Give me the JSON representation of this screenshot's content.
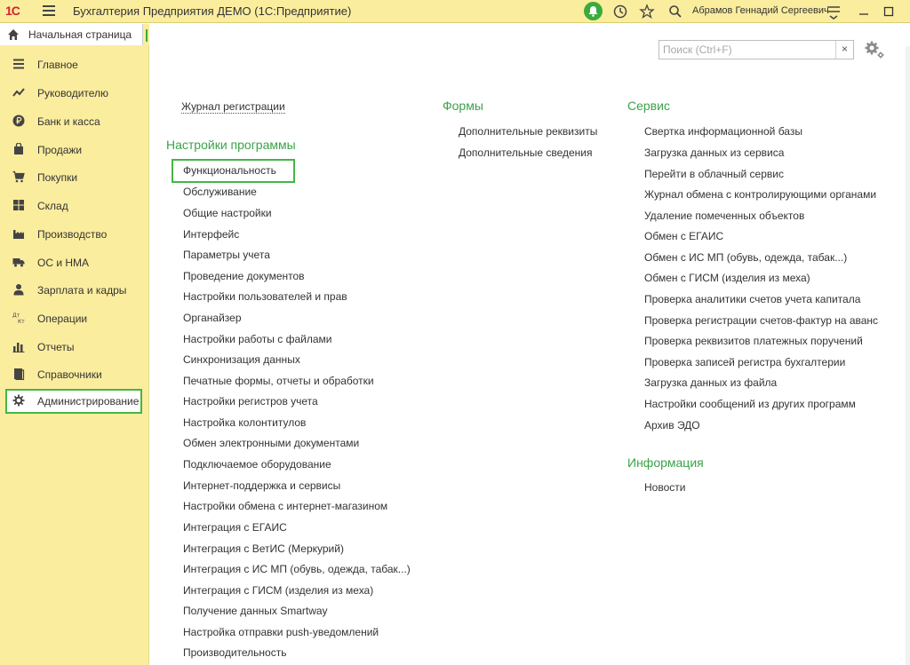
{
  "titlebar": {
    "logo": "1С",
    "title": "Бухгалтерия Предприятия ДЕМО  (1С:Предприятие)",
    "user": "Абрамов Геннадий Сергеевич"
  },
  "home_tab": {
    "label": "Начальная страница"
  },
  "sidebar": {
    "items": [
      {
        "label": "Главное",
        "icon": "menu-lines-icon"
      },
      {
        "label": "Руководителю",
        "icon": "trend-icon"
      },
      {
        "label": "Банк и касса",
        "icon": "ruble-coin-icon"
      },
      {
        "label": "Продажи",
        "icon": "bag-icon"
      },
      {
        "label": "Покупки",
        "icon": "cart-icon"
      },
      {
        "label": "Склад",
        "icon": "grid-icon"
      },
      {
        "label": "Производство",
        "icon": "factory-icon"
      },
      {
        "label": "ОС и НМА",
        "icon": "truck-icon"
      },
      {
        "label": "Зарплата и кадры",
        "icon": "person-icon"
      },
      {
        "label": "Операции",
        "icon": "dt-kt-icon"
      },
      {
        "label": "Отчеты",
        "icon": "bar-chart-icon"
      },
      {
        "label": "Справочники",
        "icon": "book-icon"
      },
      {
        "label": "Администрирование",
        "icon": "gear-icon"
      }
    ]
  },
  "search": {
    "placeholder": "Поиск (Ctrl+F)",
    "value": "",
    "clear": "×"
  },
  "content": {
    "journal": "Журнал регистрации",
    "settings": {
      "heading": "Настройки программы",
      "items": [
        "Функциональность",
        "Обслуживание",
        "Общие настройки",
        "Интерфейс",
        "Параметры учета",
        "Проведение документов",
        "Настройки пользователей и прав",
        "Органайзер",
        "Настройки работы с файлами",
        "Синхронизация данных",
        "Печатные формы, отчеты и обработки",
        "Настройки регистров учета",
        "Настройка колонтитулов",
        "Обмен электронными документами",
        "Подключаемое оборудование",
        "Интернет-поддержка и сервисы",
        "Настройки обмена с интернет-магазином",
        "Интеграция с ЕГАИС",
        "Интеграция с ВетИС (Меркурий)",
        "Интеграция с ИС МП (обувь, одежда, табак...)",
        "Интеграция с ГИСМ (изделия из меха)",
        "Получение данных Smartway",
        "Настройка отправки push-уведомлений",
        "Производительность"
      ]
    },
    "forms": {
      "heading": "Формы",
      "items": [
        "Дополнительные реквизиты",
        "Дополнительные сведения"
      ]
    },
    "service": {
      "heading": "Сервис",
      "items": [
        "Свертка информационной базы",
        "Загрузка данных из сервиса",
        "Перейти в облачный сервис",
        "Журнал обмена с контролирующими органами",
        "Удаление помеченных объектов",
        "Обмен с ЕГАИС",
        "Обмен с ИС МП (обувь, одежда, табак...)",
        "Обмен с ГИСМ (изделия из меха)",
        "Проверка аналитики счетов учета капитала",
        "Проверка регистрации счетов-фактур на аванс",
        "Проверка реквизитов платежных поручений",
        "Проверка записей регистра бухгалтерии",
        "Загрузка данных из файла",
        "Настройки сообщений из других программ",
        "Архив ЭДО"
      ]
    },
    "info": {
      "heading": "Информация",
      "items": [
        "Новости"
      ]
    }
  },
  "colors": {
    "accent_green": "#3aa347",
    "panel_yellow": "#fbed9e",
    "logo_red": "#d2232a"
  }
}
